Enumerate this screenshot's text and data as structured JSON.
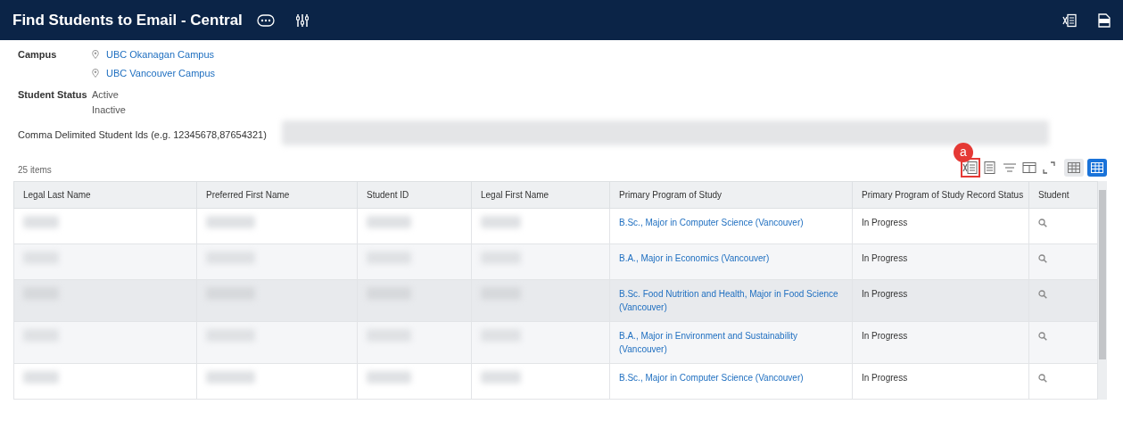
{
  "header": {
    "title": "Find Students to Email - Central"
  },
  "criteria": {
    "campus_label": "Campus",
    "campuses": [
      "UBC Okanagan Campus",
      "UBC Vancouver Campus"
    ],
    "status_label": "Student Status",
    "statuses": [
      "Active",
      "Inactive"
    ],
    "ids_label": "Comma Delimited Student Ids (e.g. 12345678,87654321)",
    "ids_redacted": true
  },
  "table": {
    "count": "25 items",
    "annotation": {
      "label": "a"
    },
    "columns": [
      "Legal Last Name",
      "Preferred First Name",
      "Student ID",
      "Legal First Name",
      "Primary Program of Study",
      "Primary Program of Study Record Status",
      "Student"
    ],
    "rows": [
      {
        "redacted": true,
        "program": "B.Sc., Major in Computer Science (Vancouver)",
        "status": "In Progress",
        "selected": false
      },
      {
        "redacted": true,
        "program": "B.A., Major in Economics (Vancouver)",
        "status": "In Progress",
        "selected": false
      },
      {
        "redacted": true,
        "program": "B.Sc. Food Nutrition and Health, Major in Food Science (Vancouver)",
        "status": "In Progress",
        "selected": true
      },
      {
        "redacted": true,
        "program": "B.A., Major in Environment and Sustainability (Vancouver)",
        "status": "In Progress",
        "selected": false
      },
      {
        "redacted": true,
        "program": "B.Sc., Major in Computer Science (Vancouver)",
        "status": "In Progress",
        "selected": false
      }
    ]
  }
}
